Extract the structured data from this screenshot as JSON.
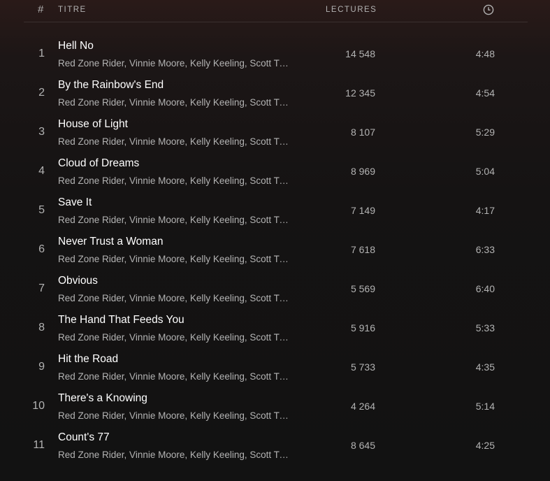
{
  "header": {
    "num_label": "#",
    "title_label": "TITRE",
    "plays_label": "LECTURES",
    "duration_icon": "clock-icon"
  },
  "tracks": [
    {
      "num": "1",
      "title": "Hell No",
      "artists": "Red Zone Rider, Vinnie Moore, Kelly Keeling, Scott Travis",
      "plays": "14 548",
      "duration": "4:48"
    },
    {
      "num": "2",
      "title": "By the Rainbow's End",
      "artists": "Red Zone Rider, Vinnie Moore, Kelly Keeling, Scott Travis",
      "plays": "12 345",
      "duration": "4:54"
    },
    {
      "num": "3",
      "title": "House of Light",
      "artists": "Red Zone Rider, Vinnie Moore, Kelly Keeling, Scott Travis",
      "plays": "8 107",
      "duration": "5:29"
    },
    {
      "num": "4",
      "title": "Cloud of Dreams",
      "artists": "Red Zone Rider, Vinnie Moore, Kelly Keeling, Scott Travis",
      "plays": "8 969",
      "duration": "5:04"
    },
    {
      "num": "5",
      "title": "Save It",
      "artists": "Red Zone Rider, Vinnie Moore, Kelly Keeling, Scott Travis",
      "plays": "7 149",
      "duration": "4:17"
    },
    {
      "num": "6",
      "title": "Never Trust a Woman",
      "artists": "Red Zone Rider, Vinnie Moore, Kelly Keeling, Scott Travis",
      "plays": "7 618",
      "duration": "6:33"
    },
    {
      "num": "7",
      "title": "Obvious",
      "artists": "Red Zone Rider, Vinnie Moore, Kelly Keeling, Scott Travis",
      "plays": "5 569",
      "duration": "6:40"
    },
    {
      "num": "8",
      "title": "The Hand That Feeds You",
      "artists": "Red Zone Rider, Vinnie Moore, Kelly Keeling, Scott Travis",
      "plays": "5 916",
      "duration": "5:33"
    },
    {
      "num": "9",
      "title": "Hit the Road",
      "artists": "Red Zone Rider, Vinnie Moore, Kelly Keeling, Scott Travis",
      "plays": "5 733",
      "duration": "4:35"
    },
    {
      "num": "10",
      "title": "There's a Knowing",
      "artists": "Red Zone Rider, Vinnie Moore, Kelly Keeling, Scott Travis",
      "plays": "4 264",
      "duration": "5:14"
    },
    {
      "num": "11",
      "title": "Count's 77",
      "artists": "Red Zone Rider, Vinnie Moore, Kelly Keeling, Scott Travis",
      "plays": "8 645",
      "duration": "4:25"
    }
  ]
}
